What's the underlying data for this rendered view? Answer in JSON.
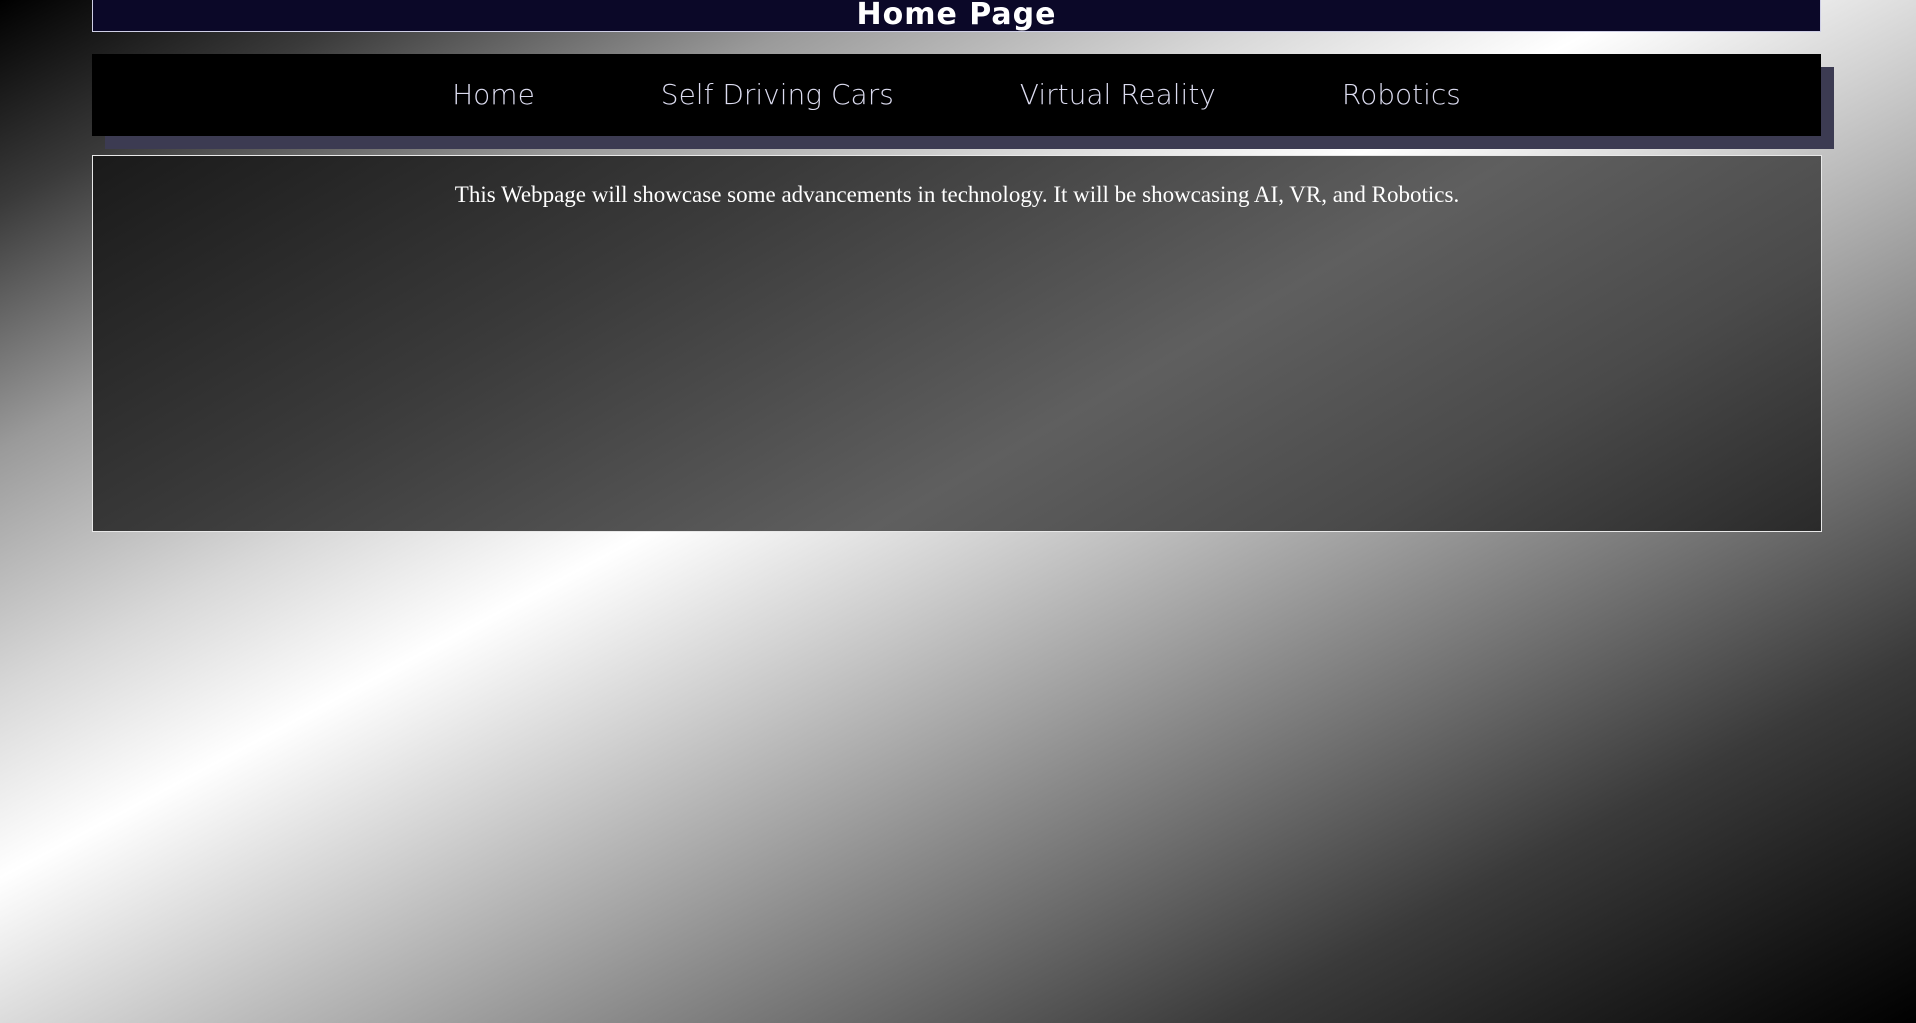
{
  "header": {
    "title": "Home Page"
  },
  "nav": {
    "items": [
      {
        "label": "Home"
      },
      {
        "label": "Self Driving Cars"
      },
      {
        "label": "Virtual Reality"
      },
      {
        "label": "Robotics"
      }
    ]
  },
  "main": {
    "intro": "This Webpage will showcase some advancements in technology. It will be showcasing AI, VR, and Robotics."
  },
  "colors": {
    "header_bg": "#0b0828",
    "nav_bg": "#000000",
    "nav_text": "#dcdcf0",
    "nav_shadow": "#3c3b52"
  }
}
